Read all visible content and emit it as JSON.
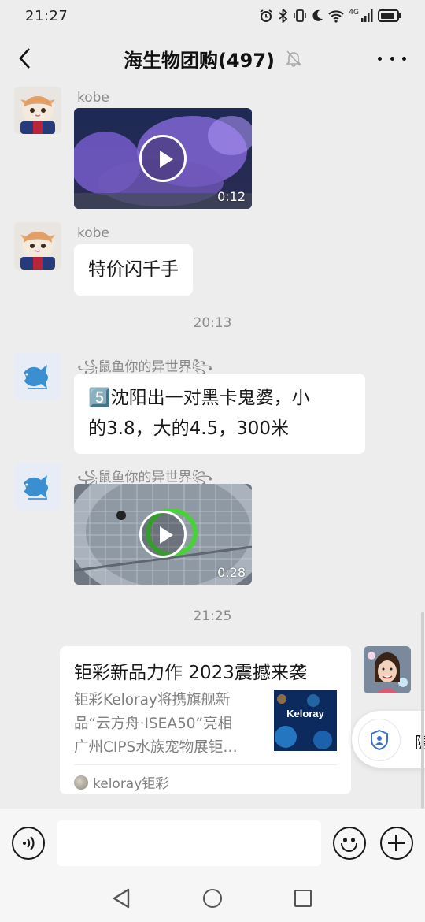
{
  "status_bar": {
    "time": "21:27",
    "network": "4G"
  },
  "header": {
    "title": "海生物团购(497)",
    "mute_icon": "bell-muted-icon"
  },
  "messages": [
    {
      "sender": "kobe",
      "type": "video",
      "duration": "0:12"
    },
    {
      "sender": "kobe",
      "type": "text",
      "text": "特价闪千手"
    },
    {
      "type": "time",
      "text": "20:13"
    },
    {
      "sender": "꧁鼠鱼你的异世界꧂",
      "type": "text",
      "line1": "5️⃣沈阳出一对黑卡鬼婆，小",
      "line2": "的3.8，大的4.5，300米"
    },
    {
      "sender": "꧁鼠鱼你的异世界꧂",
      "type": "video",
      "duration": "0:28"
    },
    {
      "type": "time",
      "text": "21:25"
    }
  ],
  "link_card": {
    "title": "钜彩新品力作 2023震撼来袭",
    "desc_line1": "钜彩Keloray将携旗舰新",
    "desc_line2": "品“云方舟·ISEA50”亮相",
    "desc_line3": "广州CIPS水族宠物展钜…",
    "thumb_text": "Keloray",
    "source": "keloray钜彩"
  },
  "privacy_float": {
    "text": "隐"
  },
  "input": {
    "placeholder": ""
  },
  "colors": {
    "background": "#ededed",
    "bubble": "#ffffff",
    "meta_text": "#8a8a8a"
  }
}
